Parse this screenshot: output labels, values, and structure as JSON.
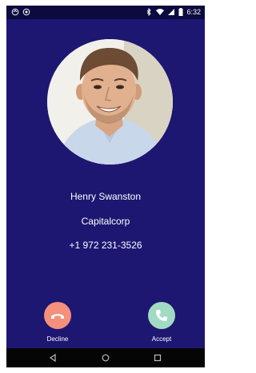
{
  "status_bar": {
    "time": "6:32",
    "left_icons": [
      "sync-icon",
      "nfc-icon"
    ],
    "right_icons": [
      "bluetooth-icon",
      "wifi-icon",
      "signal-icon",
      "battery-icon"
    ]
  },
  "caller": {
    "name": "Henry Swanston",
    "company": "Capitalcorp",
    "phone": "+1 972 231-3526"
  },
  "actions": {
    "decline_label": "Decline",
    "accept_label": "Accept"
  },
  "colors": {
    "background": "#1d1772",
    "decline": "#f4907c",
    "accept": "#a2dbc3"
  },
  "nav_bar": {
    "icons": [
      "back-icon",
      "home-icon",
      "recents-icon"
    ]
  }
}
